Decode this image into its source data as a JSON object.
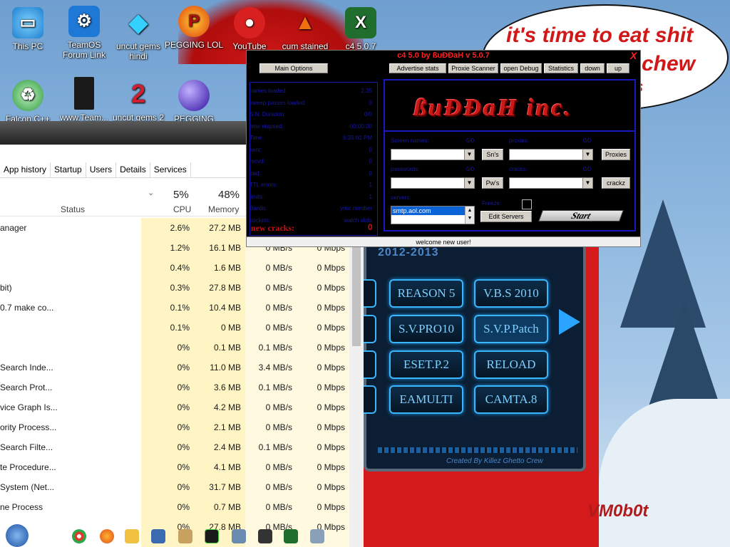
{
  "wallpaper": {
    "speech_text": "it's time to eat shit chew",
    "speech_line1": "it's time to eat shit",
    "speech_line2": "chew",
    "speech_line3": "s",
    "watermark": "VM0b0t"
  },
  "desktop_icons": [
    {
      "label": "This PC",
      "icon": "monitor-icon"
    },
    {
      "label": "TeamOS Forum Link",
      "icon": "gear-icon"
    },
    {
      "label": "uncut gems hindi",
      "icon": "diamond-icon"
    },
    {
      "label": "PEGGING LOL",
      "icon": "p-letter-icon"
    },
    {
      "label": "YouTube",
      "icon": "angry-bird-icon"
    },
    {
      "label": "cum stained",
      "icon": "cone-icon"
    },
    {
      "label": "c4 5.0.7",
      "icon": "excel-icon"
    },
    {
      "label": "Falcon C++",
      "icon": "recycle-icon"
    },
    {
      "label": "www.Team...",
      "icon": "book-icon"
    },
    {
      "label": "uncut gems 2",
      "icon": "number-2-icon"
    },
    {
      "label": "PEGGING",
      "icon": "orb-icon"
    }
  ],
  "task_manager": {
    "tabs": [
      "App history",
      "Startup",
      "Users",
      "Details",
      "Services"
    ],
    "columns": {
      "status": "Status",
      "cpu_pct": "5%",
      "cpu": "CPU",
      "mem_pct": "48%",
      "memory": "Memory"
    },
    "rows": [
      {
        "name": "anager",
        "cpu": "2.6%",
        "mem": "27.2 MB",
        "disk": "",
        "net": ""
      },
      {
        "name": "",
        "cpu": "1.2%",
        "mem": "16.1 MB",
        "disk": "0 MB/s",
        "net": "0 Mbps"
      },
      {
        "name": "",
        "cpu": "0.4%",
        "mem": "1.6 MB",
        "disk": "0 MB/s",
        "net": "0 Mbps"
      },
      {
        "name": "bit)",
        "cpu": "0.3%",
        "mem": "27.8 MB",
        "disk": "0 MB/s",
        "net": "0 Mbps"
      },
      {
        "name": "0.7 make co...",
        "cpu": "0.1%",
        "mem": "10.4 MB",
        "disk": "0 MB/s",
        "net": "0 Mbps"
      },
      {
        "name": "",
        "cpu": "0.1%",
        "mem": "0 MB",
        "disk": "0 MB/s",
        "net": "0 Mbps"
      },
      {
        "name": "",
        "cpu": "0%",
        "mem": "0.1 MB",
        "disk": "0.1 MB/s",
        "net": "0 Mbps"
      },
      {
        "name": "Search Inde...",
        "cpu": "0%",
        "mem": "11.0 MB",
        "disk": "3.4 MB/s",
        "net": "0 Mbps"
      },
      {
        "name": "Search Prot...",
        "cpu": "0%",
        "mem": "3.6 MB",
        "disk": "0.1 MB/s",
        "net": "0 Mbps"
      },
      {
        "name": "vice Graph Is...",
        "cpu": "0%",
        "mem": "4.2 MB",
        "disk": "0 MB/s",
        "net": "0 Mbps"
      },
      {
        "name": "ority Process...",
        "cpu": "0%",
        "mem": "2.1 MB",
        "disk": "0 MB/s",
        "net": "0 Mbps"
      },
      {
        "name": "Search Filte...",
        "cpu": "0%",
        "mem": "2.4 MB",
        "disk": "0.1 MB/s",
        "net": "0 Mbps"
      },
      {
        "name": "te Procedure...",
        "cpu": "0%",
        "mem": "4.1 MB",
        "disk": "0 MB/s",
        "net": "0 Mbps"
      },
      {
        "name": "System (Net...",
        "cpu": "0%",
        "mem": "31.7 MB",
        "disk": "0 MB/s",
        "net": "0 Mbps"
      },
      {
        "name": "ne Process",
        "cpu": "0%",
        "mem": "0.7 MB",
        "disk": "0 MB/s",
        "net": "0 Mbps"
      },
      {
        "name": "",
        "cpu": "0%",
        "mem": "27.8 MB",
        "disk": "0 MB/s",
        "net": "0 Mbps"
      }
    ]
  },
  "skin": {
    "title": "2012-2013",
    "buttons": [
      "REASON 5",
      "V.B.S 2010",
      "S.V.PRO10",
      "S.V.P.Patch",
      "ESET.P.2",
      "RELOAD",
      "EAMULTI",
      "CAMTA.8"
    ],
    "credit": "Created By Killez Ghetto Crew"
  },
  "c4": {
    "title": "c4 5.0 by ßuÐÐaH v 5.0.7",
    "close": "X",
    "main_options": "Main Options",
    "toolbar": [
      "Advertise stats",
      "Proxie Scanner",
      "open Debug",
      "Statistics",
      "down",
      "up"
    ],
    "stats": [
      {
        "label": "names loaded:",
        "value": "2.35"
      },
      {
        "label": "sweep passes loaded:",
        "value": "0"
      },
      {
        "label": "S.N. Duration:",
        "value": "0/0"
      },
      {
        "label": "time elapsed:",
        "value": "00:00:00"
      },
      {
        "label": "Time:",
        "value": "6:35:01 PM"
      },
      {
        "label": "sent:",
        "value": "0"
      },
      {
        "label": "recvd:",
        "value": "0"
      },
      {
        "label": "bad:",
        "value": "0"
      },
      {
        "label": "TTL errors:",
        "value": "1"
      },
      {
        "label": "limits:",
        "value": "1"
      },
      {
        "label": "Bands:",
        "value": "your number"
      },
      {
        "label": "sockets:",
        "value": "watch slots"
      }
    ],
    "new_cracks_label": "new cracks:",
    "new_cracks_value": "0",
    "logo": "ßuÐÐaH inc.",
    "screen_names_label": "Screen names:",
    "screen_names_count": "0/0",
    "proxies_label": "proxies:",
    "proxies_count": "0/0",
    "passwords_label": "passwords:",
    "passwords_count": "0/0",
    "cracks_label": "cracks:",
    "cracks_count": "0/0",
    "servers_label": "servers:",
    "server_selected": "smtp.aol.com",
    "freeze_label": "Freeze:",
    "sns_button": "Sn's",
    "proxies_button": "Proxies",
    "pws_button": "Pw's",
    "crackz_button": "crackz",
    "edit_servers": "Edit Servers",
    "start": "Start",
    "status": "welcome new user!"
  }
}
